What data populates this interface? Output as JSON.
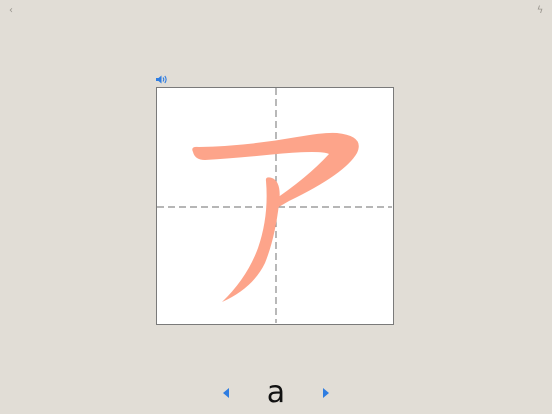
{
  "toolbar": {
    "left_icon": "back-chevron-icon",
    "left_glyph": "‹",
    "right_icon": "lightning-icon",
    "right_glyph": "ϟ"
  },
  "card": {
    "sound_icon": "speaker-icon",
    "character": "ア",
    "stroke_color": "#fda48a",
    "guide_color": "#8a8a8a"
  },
  "nav": {
    "romaji": "a",
    "prev_icon": "triangle-left-icon",
    "next_icon": "triangle-right-icon",
    "accent_color": "#2f7de1"
  }
}
